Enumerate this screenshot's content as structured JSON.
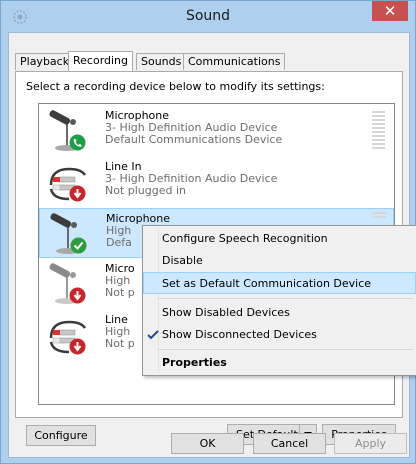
{
  "window": {
    "title": "Sound",
    "close_glyph": "✕"
  },
  "tabs": [
    {
      "label": "Playback",
      "active": false
    },
    {
      "label": "Recording",
      "active": true
    },
    {
      "label": "Sounds",
      "active": false
    },
    {
      "label": "Communications",
      "active": false
    }
  ],
  "instruction": "Select a recording device below to modify its settings:",
  "devices": [
    {
      "name": "Microphone",
      "line1": "3- High Definition Audio Device",
      "line2": "Default Communications Device",
      "icon": "microphone-icon",
      "status_icon": "phone-badge-icon",
      "selected": false
    },
    {
      "name": "Line In",
      "line1": "3- High Definition Audio Device",
      "line2": "Not plugged in",
      "icon": "line-in-cable-icon",
      "status_icon": "unplugged-badge-icon",
      "selected": false
    },
    {
      "name": "Microphone",
      "line1": "High",
      "line2": "Defa",
      "icon": "microphone-icon",
      "status_icon": "check-badge-icon",
      "selected": true
    },
    {
      "name": "Micro",
      "line1": "High",
      "line2": "Not p",
      "icon": "microphone-icon",
      "status_icon": "unplugged-badge-icon",
      "selected": false
    },
    {
      "name": "Line",
      "line1": "High",
      "line2": "Not p",
      "icon": "line-in-cable-icon",
      "status_icon": "unplugged-badge-icon",
      "selected": false
    }
  ],
  "buttons": {
    "configure": "Configure",
    "set_default": "Set Default",
    "properties": "Properties",
    "ok": "OK",
    "cancel": "Cancel",
    "apply": "Apply"
  },
  "context_menu": {
    "items": [
      {
        "label": "Configure Speech Recognition"
      },
      {
        "label": "Disable"
      },
      {
        "label": "Set as Default Communication Device",
        "highlighted": true
      },
      {
        "label": "Show Disabled Devices"
      },
      {
        "label": "Show Disconnected Devices",
        "checked": true
      },
      {
        "label": "Properties",
        "bold": true
      }
    ]
  },
  "colors": {
    "title_bar": "#aed0ee",
    "close_button": "#c75050",
    "selection": "#cce8ff",
    "menu_highlight": "#cde8ff",
    "check_green": "#2e9b3e",
    "phone_green": "#1f9e4a",
    "unplugged_red": "#c8262b"
  }
}
